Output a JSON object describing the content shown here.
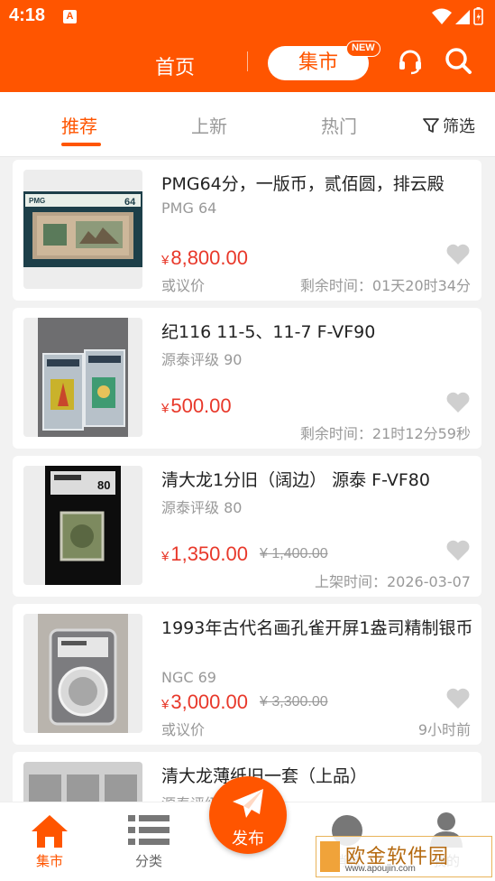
{
  "status_bar": {
    "time": "4:18",
    "notification_glyph": "A"
  },
  "header": {
    "home_label": "首页",
    "market_label": "集市",
    "new_badge": "NEW"
  },
  "tabs": [
    {
      "label": "推荐",
      "active": true
    },
    {
      "label": "上新",
      "active": false
    },
    {
      "label": "热门",
      "active": false
    }
  ],
  "filter_label": "筛选",
  "listings": [
    {
      "title": "PMG64分，一版币，贰佰圆，排云殿",
      "grade": "PMG 64",
      "price": "8,800.00",
      "currency_symbol": "¥",
      "negotiable": "或议价",
      "right_info": "剩余时间：01天20时34分",
      "image": "pmg-banknote"
    },
    {
      "title": "纪116 11-5、11-7 F-VF90",
      "grade": "源泰评级 90",
      "price": "500.00",
      "currency_symbol": "¥",
      "right_info": "剩余时间：21时12分59秒",
      "image": "graded-stamps-pair"
    },
    {
      "title": "清大龙1分旧（阔边） 源泰 F-VF80",
      "grade": "源泰评级 80",
      "price": "1,350.00",
      "old_price": "¥ 1,400.00",
      "currency_symbol": "¥",
      "right_info": "上架时间：2026-03-07",
      "image": "graded-dragon-stamp"
    },
    {
      "title": "1993年古代名画孔雀开屏1盎司精制银币",
      "grade": "NGC 69",
      "price": "3,000.00",
      "old_price": "¥ 3,300.00",
      "currency_symbol": "¥",
      "negotiable": "或议价",
      "right_info": "9小时前",
      "image": "ngc-silver-coin"
    },
    {
      "title": "清大龙薄纸旧一套（上品）",
      "grade": "源泰评级",
      "image": "graded-stamp-set"
    }
  ],
  "bottom_nav": [
    {
      "label": "集市",
      "icon": "home-icon",
      "active": true
    },
    {
      "label": "分类",
      "icon": "list-icon",
      "active": false
    },
    {
      "label": "消息",
      "icon": "message-icon",
      "active": false
    },
    {
      "label": "我的",
      "icon": "user-icon",
      "active": false
    }
  ],
  "publish_label": "发布",
  "watermark": {
    "text": "欧金软件园",
    "url": "www.apoujin.com"
  },
  "colors": {
    "brand": "#ff5500",
    "price": "#e8382a"
  }
}
